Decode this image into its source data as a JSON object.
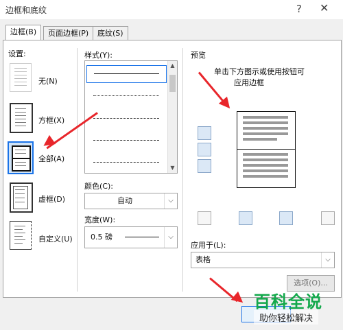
{
  "window": {
    "title": "边框和底纹",
    "help_icon": "?",
    "close_icon": "✕"
  },
  "tabs": [
    {
      "label": "边框(B)"
    },
    {
      "label": "页面边框(P)"
    },
    {
      "label": "底纹(S)"
    }
  ],
  "settings": {
    "label": "设置:",
    "items": [
      {
        "label": "无(N)"
      },
      {
        "label": "方框(X)"
      },
      {
        "label": "全部(A)"
      },
      {
        "label": "虚框(D)"
      },
      {
        "label": "自定义(U)"
      }
    ],
    "selected_index": 2
  },
  "style": {
    "label": "样式(Y):",
    "selected_index": 0,
    "scroll_fraction": 0.2
  },
  "color": {
    "label": "颜色(C):",
    "value": "自动"
  },
  "width": {
    "label": "宽度(W):",
    "value": "0.5 磅"
  },
  "preview": {
    "label": "预览",
    "hint_line1": "单击下方图示或使用按钮可",
    "hint_line2": "应用边框"
  },
  "apply_to": {
    "label": "应用于(L):",
    "value": "表格"
  },
  "buttons": {
    "options_label": "选项(O)..."
  },
  "watermark": {
    "main": "百科全说",
    "sub": "助你轻松解决"
  },
  "colors": {
    "accent": "#1a73e8",
    "arrow": "#e8262b",
    "watermark": "#13a84b"
  }
}
